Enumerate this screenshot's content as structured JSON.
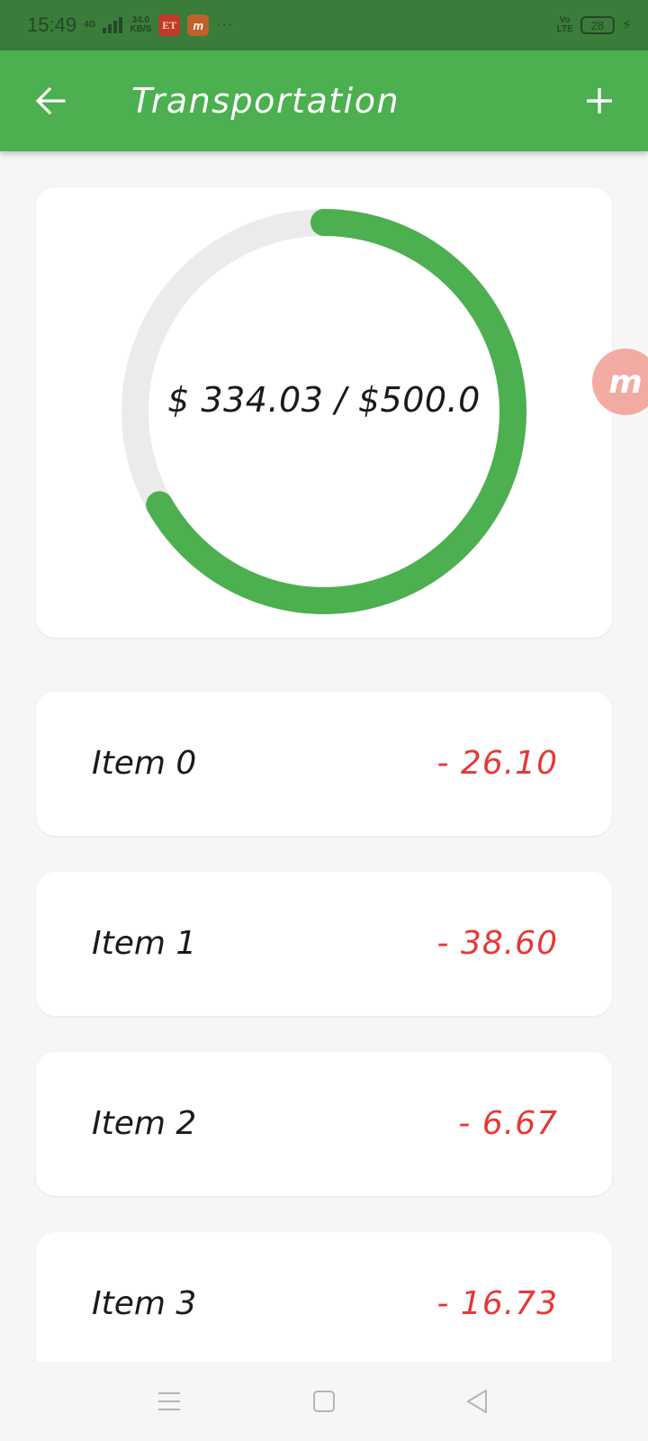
{
  "status_bar": {
    "time": "15:49",
    "network": "4G",
    "speed_value": "34.0",
    "speed_unit": "KB/S",
    "app_icon_1": "ET",
    "app_icon_2": "m",
    "more": "···",
    "volte_top": "Vo",
    "volte_bottom": "LTE",
    "battery": "28"
  },
  "app_bar": {
    "title": "Transportation",
    "back_icon": "arrow-back-icon",
    "add_icon": "plus-icon"
  },
  "budget": {
    "spent": 334.03,
    "limit": 500.0,
    "label": "$ 334.03 / $500.0",
    "progress_color": "#4caf50",
    "track_color": "#ebebeb"
  },
  "floating_bubble": {
    "letter": "m",
    "color": "#f1a59d"
  },
  "expenses": [
    {
      "name": "Item 0",
      "amount": "- 26.10"
    },
    {
      "name": "Item 1",
      "amount": "- 38.60"
    },
    {
      "name": "Item 2",
      "amount": "- 6.67"
    },
    {
      "name": "Item 3",
      "amount": "- 16.73"
    }
  ],
  "colors": {
    "primary": "#4caf50",
    "status_bar": "#3a7d3b",
    "negative_amount": "#e53935"
  },
  "nav_bar": {
    "menu_icon": "menu-icon",
    "home_icon": "square-icon",
    "back_icon": "triangle-back-icon"
  }
}
